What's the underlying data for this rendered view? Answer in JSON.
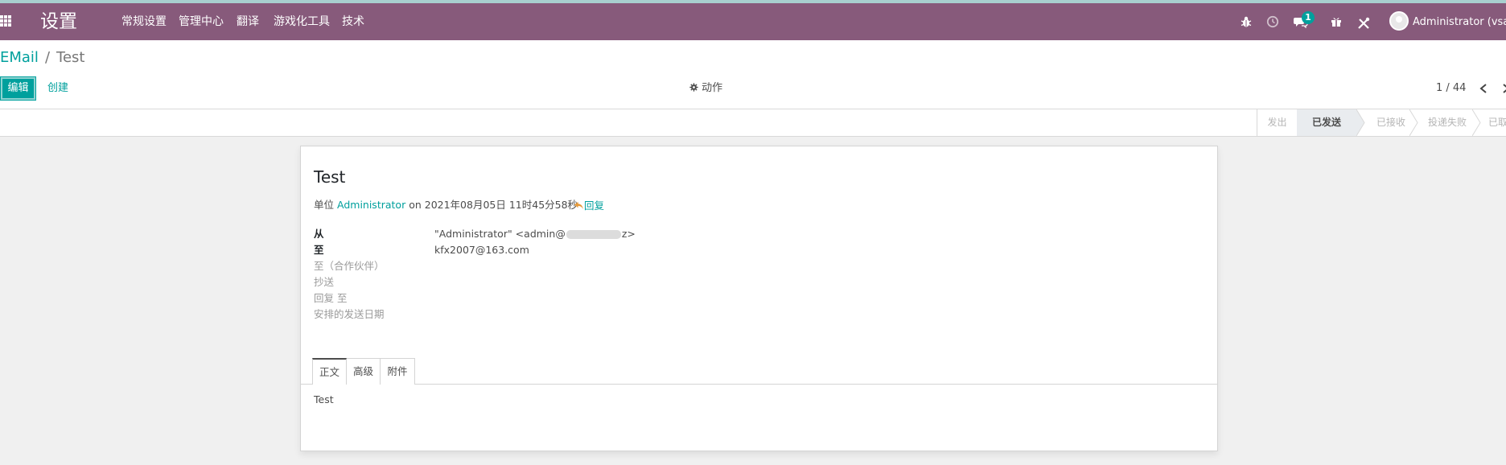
{
  "app": {
    "title": "设置",
    "menu": [
      "常规设置",
      "管理中心",
      "翻译",
      "游戏化工具",
      "技术"
    ],
    "message_count": "1",
    "user_name": "Administrator (vsahi"
  },
  "breadcrumb": {
    "parent": "EMail",
    "separator": "/",
    "current": "Test"
  },
  "toolbar": {
    "edit_label": "编辑",
    "create_label": "创建",
    "action_label": "动作",
    "pager": "1 / 44"
  },
  "statusbar": {
    "stages": [
      "发出",
      "已发送",
      "已接收",
      "投递失败",
      "已取"
    ],
    "current": "已发送"
  },
  "email": {
    "subject": "Test",
    "meta_prefix": "单位",
    "author": "Administrator",
    "date_text": "on 2021年08月05日 11时45分58秒",
    "reply_label": "回复",
    "fields": {
      "from_label": "从",
      "from_value_start": "\"Administrator\" <admin@",
      "from_value_end": "z>",
      "to_label": "至",
      "to_value": "kfx2007@163.com",
      "to_partners_label": "至（合作伙伴）",
      "cc_label": "抄送",
      "reply_to_label": "回复 至",
      "scheduled_date_label": "安排的发送日期"
    },
    "tabs": [
      "正文",
      "高级",
      "附件"
    ],
    "body": "Test"
  }
}
